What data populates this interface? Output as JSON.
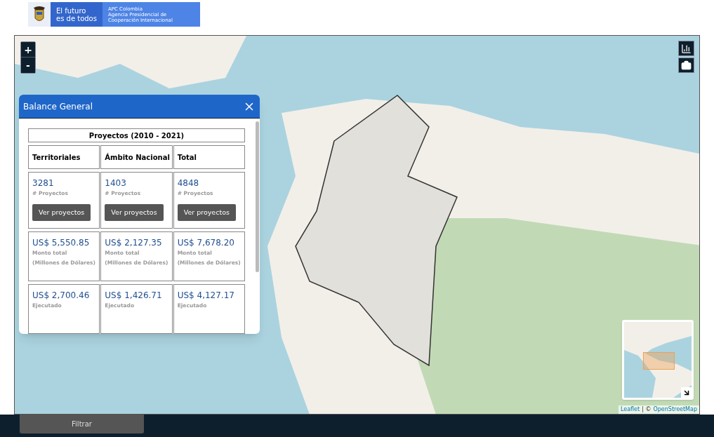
{
  "header": {
    "slogan": [
      "El futuro",
      "es de todos"
    ],
    "agency": [
      "APC Colombia",
      "Agencia Presidencial de",
      "Cooperación Internacional"
    ]
  },
  "map": {
    "zoom_in": "+",
    "zoom_out": "-",
    "attribution": {
      "link1": "Leaflet",
      "separator": "| ©",
      "link2": "OpenStreetMap"
    }
  },
  "panel": {
    "title": "Balance General",
    "table_title": "Proyectos (2010 - 2021)",
    "columns": [
      "Territoriales",
      "Ámbito Nacional",
      "Total"
    ],
    "rows": [
      {
        "cells": [
          {
            "value": "3281",
            "label": "# Proyectos",
            "button": "Ver proyectos"
          },
          {
            "value": "1403",
            "label": "# Proyectos",
            "button": "Ver proyectos"
          },
          {
            "value": "4848",
            "label": "# Proyectos",
            "button": "Ver proyectos"
          }
        ]
      },
      {
        "cells": [
          {
            "value": "US$ 5,550.85",
            "label": "Monto total (Millones de Dólares)"
          },
          {
            "value": "US$ 2,127.35",
            "label": "Monto total (Millones de Dólares)"
          },
          {
            "value": "US$ 7,678.20",
            "label": "Monto total (Millones de Dólares)"
          }
        ]
      },
      {
        "cells": [
          {
            "value": "US$ 2,700.46",
            "label": "Ejecutado"
          },
          {
            "value": "US$ 1,426.71",
            "label": "Ejecutado"
          },
          {
            "value": "US$ 4,127.17",
            "label": "Ejecutado"
          }
        ]
      }
    ]
  },
  "footer": {
    "filter_button": "Filtrar"
  }
}
